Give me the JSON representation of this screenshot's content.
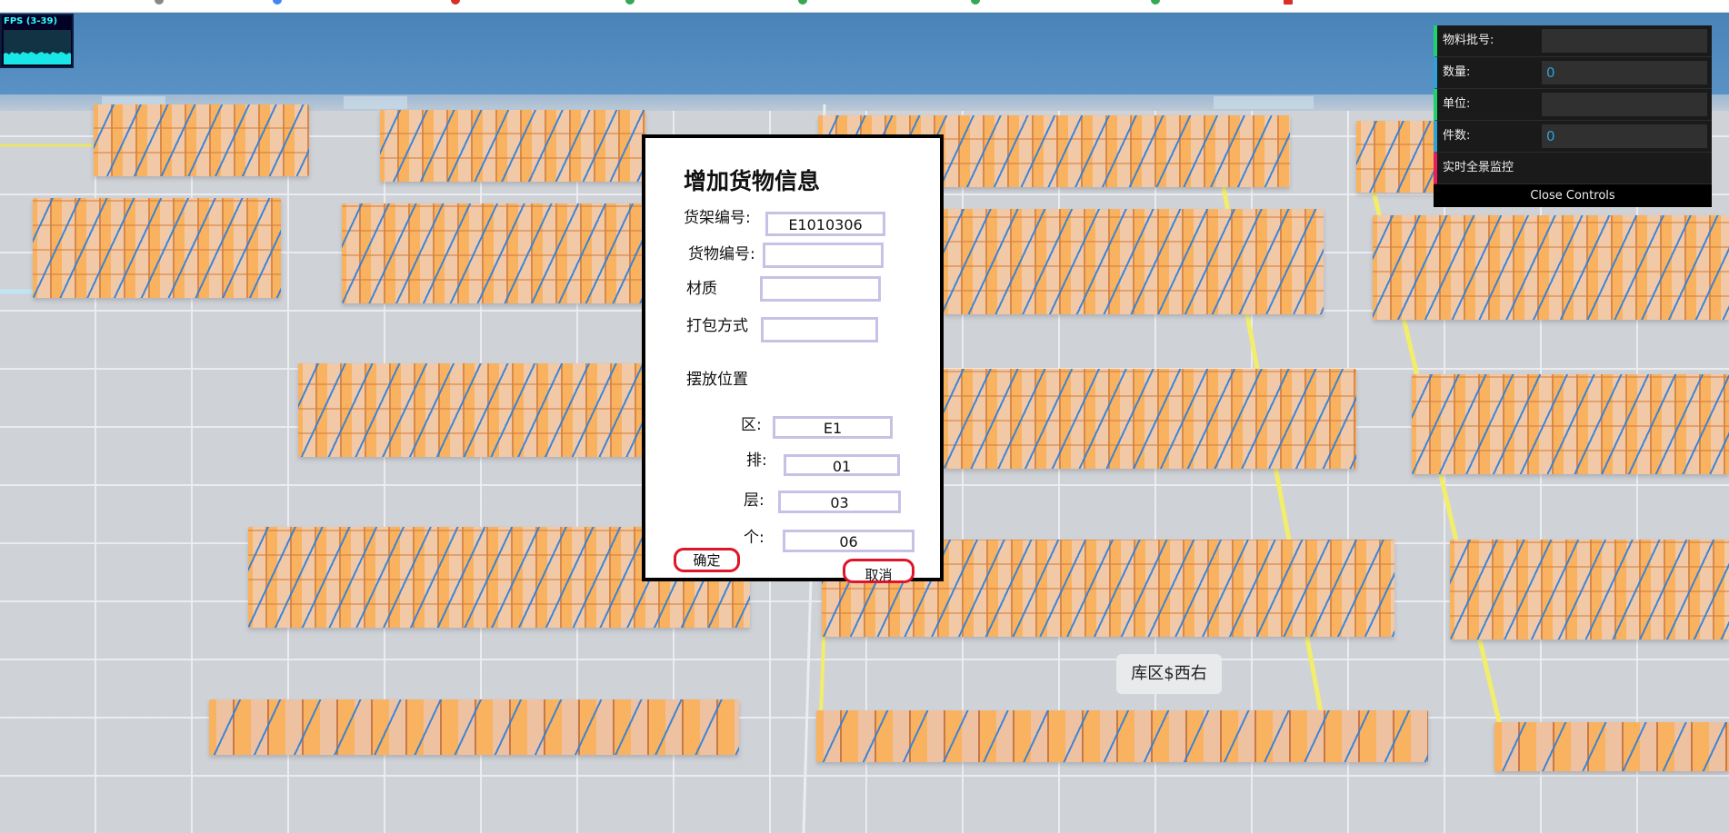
{
  "fps_panel": {
    "label": "FPS (3-39)"
  },
  "dialog": {
    "title": "增加货物信息",
    "shelf_no": {
      "label": "货架编号:",
      "value": "E1010306"
    },
    "goods_no": {
      "label": "货物编号:",
      "value": ""
    },
    "material": {
      "label": "材质",
      "value": ""
    },
    "packing": {
      "label": "打包方式",
      "value": ""
    },
    "position_heading": "摆放位置",
    "zone": {
      "label": "区:",
      "value": "E1"
    },
    "row": {
      "label": "排:",
      "value": "01"
    },
    "layer": {
      "label": "层:",
      "value": "03"
    },
    "slot": {
      "label": "个:",
      "value": "06"
    },
    "confirm_label": "确定",
    "cancel_label": "取消"
  },
  "controls": {
    "material_batch": {
      "label": "物料批号:",
      "value": ""
    },
    "quantity": {
      "label": "数量:",
      "value": "0"
    },
    "unit": {
      "label": "单位:",
      "value": ""
    },
    "pieces": {
      "label": "件数:",
      "value": "0"
    },
    "panorama_label": "实时全景监控",
    "close_label": "Close Controls"
  },
  "scene": {
    "zone_label": "库区$西右"
  },
  "colors": {
    "string_row": "#1ed36f",
    "number_row": "#2fa1d6",
    "function_row": "#e61d5f",
    "button_border": "#e0142a",
    "input_border": "#c8c1e6",
    "rack": "#f6ad5c",
    "rack_line": "#2a7ede",
    "floor_line": "#f2ee6c"
  }
}
